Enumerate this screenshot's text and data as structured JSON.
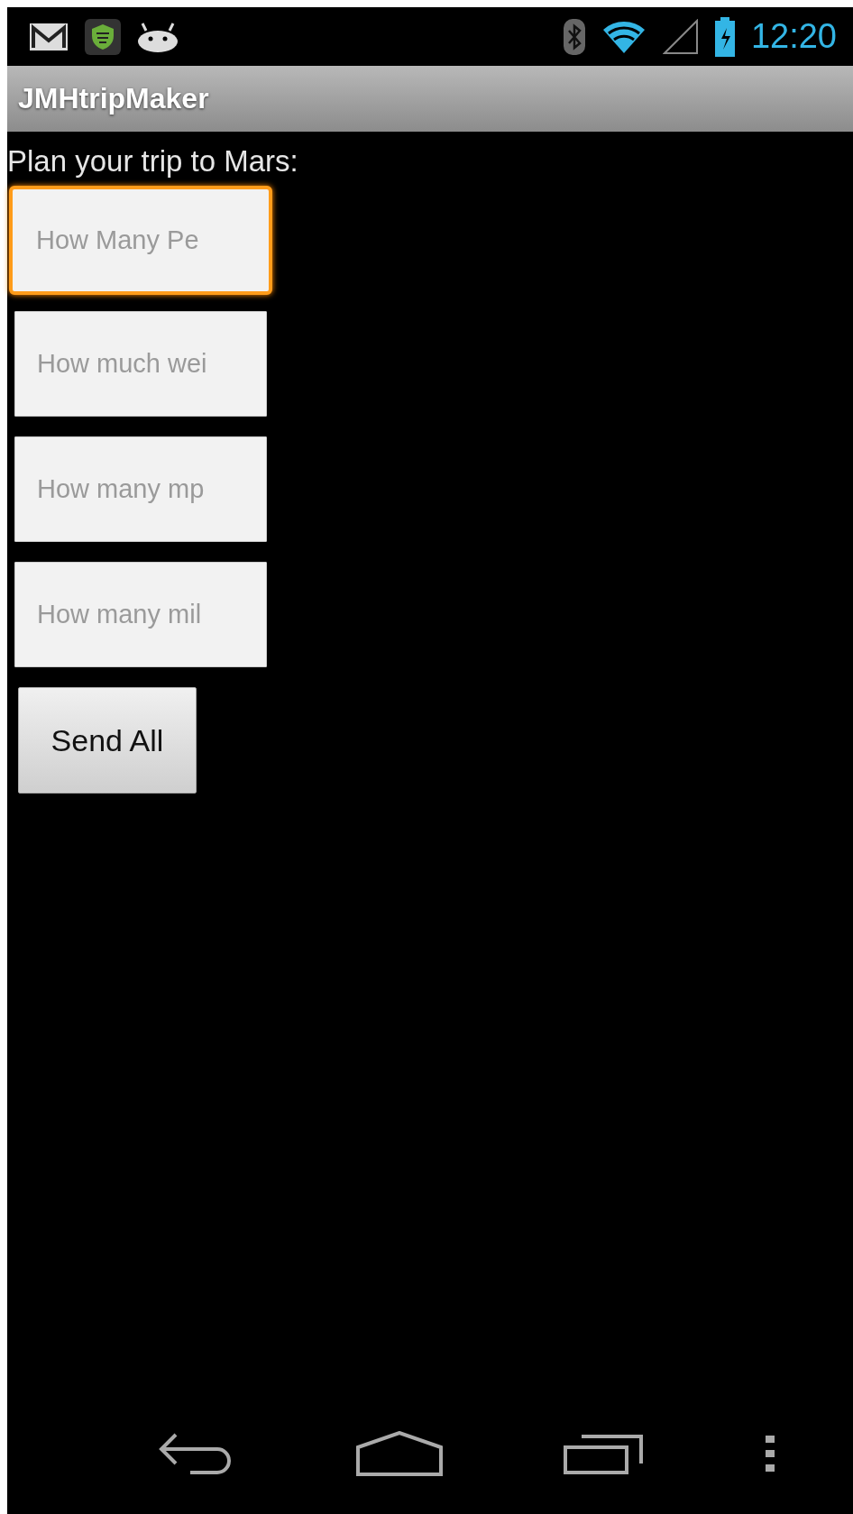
{
  "status_bar": {
    "time": "12:20"
  },
  "action_bar": {
    "title": "JMHtripMaker"
  },
  "prompt": "Plan your trip to Mars:",
  "fields": [
    {
      "placeholder": "How Many Pe",
      "focused": true
    },
    {
      "placeholder": "How much wei",
      "focused": false
    },
    {
      "placeholder": "How many mp",
      "focused": false
    },
    {
      "placeholder": "How many mil",
      "focused": false
    }
  ],
  "button": "Send All"
}
